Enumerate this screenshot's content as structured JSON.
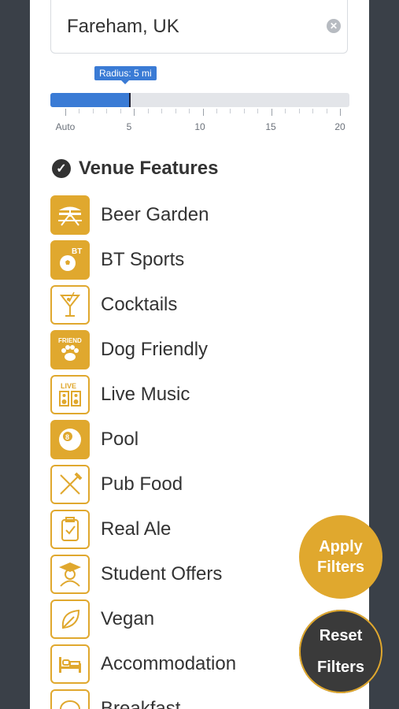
{
  "search": {
    "value": "Fareham, UK"
  },
  "radius": {
    "tooltip": "Radius: 5 mi",
    "tick_labels": [
      "Auto",
      "5",
      "10",
      "15",
      "20"
    ],
    "value": 5,
    "max": 20
  },
  "section": {
    "title": "Venue Features"
  },
  "features": [
    {
      "label": "Beer Garden",
      "icon": "picnic-table-icon",
      "style": "filled"
    },
    {
      "label": "BT Sports",
      "icon": "soccer-ball-icon",
      "style": "filled"
    },
    {
      "label": "Cocktails",
      "icon": "cocktail-glass-icon",
      "style": "outline"
    },
    {
      "label": "Dog Friendly",
      "icon": "paw-icon",
      "style": "filled"
    },
    {
      "label": "Live Music",
      "icon": "speakers-icon",
      "style": "outline"
    },
    {
      "label": "Pool",
      "icon": "eight-ball-icon",
      "style": "filled"
    },
    {
      "label": "Pub Food",
      "icon": "fork-knife-icon",
      "style": "outline"
    },
    {
      "label": "Real Ale",
      "icon": "beer-pump-icon",
      "style": "outline"
    },
    {
      "label": "Student Offers",
      "icon": "graduate-icon",
      "style": "outline"
    },
    {
      "label": "Vegan",
      "icon": "leaf-icon",
      "style": "outline"
    },
    {
      "label": "Accommodation",
      "icon": "bed-icon",
      "style": "outline"
    },
    {
      "label": "Breakfast",
      "icon": "breakfast-icon",
      "style": "outline"
    }
  ],
  "buttons": {
    "apply": "Apply Filters",
    "reset": "Reset Filters"
  },
  "colors": {
    "accent": "#e0a82e",
    "slider": "#3a7bd5",
    "background": "#3a4048"
  }
}
